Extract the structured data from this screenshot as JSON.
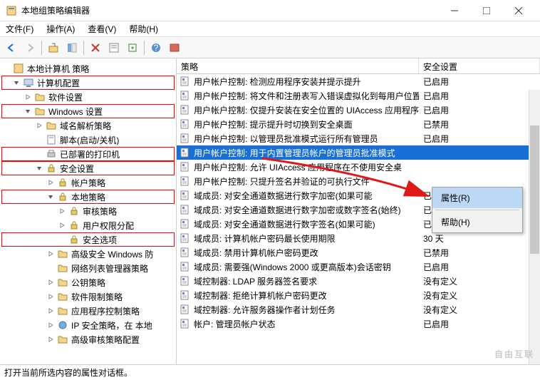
{
  "window": {
    "title": "本地组策略编辑器"
  },
  "menu": {
    "file": "文件(F)",
    "action": "操作(A)",
    "view": "查看(V)",
    "help": "帮助(H)"
  },
  "tree": [
    {
      "indent": 0,
      "label": "本地计算机 策略",
      "twisty": "",
      "icon": "policy",
      "hl": false
    },
    {
      "indent": 1,
      "label": "计算机配置",
      "twisty": "v",
      "icon": "computer",
      "hl": true
    },
    {
      "indent": 2,
      "label": "软件设置",
      "twisty": ">",
      "icon": "folder",
      "hl": false
    },
    {
      "indent": 2,
      "label": "Windows 设置",
      "twisty": "v",
      "icon": "folder",
      "hl": true
    },
    {
      "indent": 3,
      "label": "域名解析策略",
      "twisty": ">",
      "icon": "folder",
      "hl": false
    },
    {
      "indent": 3,
      "label": "脚本(启动/关机)",
      "twisty": "",
      "icon": "script",
      "hl": false
    },
    {
      "indent": 3,
      "label": "已部署的打印机",
      "twisty": "",
      "icon": "printer",
      "hl": true
    },
    {
      "indent": 3,
      "label": "安全设置",
      "twisty": "v",
      "icon": "lock",
      "hl": true
    },
    {
      "indent": 4,
      "label": "帐户策略",
      "twisty": ">",
      "icon": "lock",
      "hl": false
    },
    {
      "indent": 4,
      "label": "本地策略",
      "twisty": "v",
      "icon": "lock",
      "hl": true
    },
    {
      "indent": 5,
      "label": "审核策略",
      "twisty": ">",
      "icon": "lock",
      "hl": false
    },
    {
      "indent": 5,
      "label": "用户权限分配",
      "twisty": ">",
      "icon": "lock",
      "hl": false
    },
    {
      "indent": 5,
      "label": "安全选项",
      "twisty": "",
      "icon": "lock",
      "hl": true
    },
    {
      "indent": 4,
      "label": "高级安全 Windows 防",
      "twisty": ">",
      "icon": "folder",
      "hl": false
    },
    {
      "indent": 4,
      "label": "网络列表管理器策略",
      "twisty": "",
      "icon": "folder",
      "hl": false
    },
    {
      "indent": 4,
      "label": "公钥策略",
      "twisty": ">",
      "icon": "folder",
      "hl": false
    },
    {
      "indent": 4,
      "label": "软件限制策略",
      "twisty": ">",
      "icon": "folder",
      "hl": false
    },
    {
      "indent": 4,
      "label": "应用程序控制策略",
      "twisty": ">",
      "icon": "folder",
      "hl": false
    },
    {
      "indent": 4,
      "label": "IP 安全策略，在 本地",
      "twisty": ">",
      "icon": "ip",
      "hl": false
    },
    {
      "indent": 4,
      "label": "高级审核策略配置",
      "twisty": ">",
      "icon": "folder",
      "hl": false
    }
  ],
  "columns": {
    "policy": "策略",
    "setting": "安全设置"
  },
  "rows": [
    {
      "name": "用户帐户控制: 检测应用程序安装并提示提升",
      "setting": "已启用",
      "sel": false
    },
    {
      "name": "用户帐户控制: 将文件和注册表写入错误虚拟化到每用户位置",
      "setting": "已启用",
      "sel": false
    },
    {
      "name": "用户帐户控制: 仅提升安装在安全位置的 UIAccess 应用程序",
      "setting": "已启用",
      "sel": false
    },
    {
      "name": "用户帐户控制: 提示提升时切换到安全桌面",
      "setting": "已禁用",
      "sel": false
    },
    {
      "name": "用户帐户控制: 以管理员批准模式运行所有管理员",
      "setting": "已启用",
      "sel": false
    },
    {
      "name": "用户帐户控制: 用于内置管理员帐户的管理员批准模式",
      "setting": "",
      "sel": true
    },
    {
      "name": "用户帐户控制: 允许 UIAccess 应用程序在不使用安全桌",
      "setting": "",
      "sel": false
    },
    {
      "name": "用户帐户控制: 只提升签名并验证的可执行文件",
      "setting": "",
      "sel": false
    },
    {
      "name": "域成员: 对安全通道数据进行数字加密(如果可能",
      "setting": "已启用",
      "sel": false
    },
    {
      "name": "域成员: 对安全通道数据进行数字加密或数字签名(始终)",
      "setting": "已启用",
      "sel": false
    },
    {
      "name": "域成员: 对安全通道数据进行数字签名(如果可能)",
      "setting": "已启用",
      "sel": false
    },
    {
      "name": "域成员: 计算机帐户密码最长使用期限",
      "setting": "30 天",
      "sel": false
    },
    {
      "name": "域成员: 禁用计算机帐户密码更改",
      "setting": "已禁用",
      "sel": false
    },
    {
      "name": "域成员: 需要强(Windows 2000 或更高版本)会话密钥",
      "setting": "已启用",
      "sel": false
    },
    {
      "name": "域控制器: LDAP 服务器签名要求",
      "setting": "没有定义",
      "sel": false
    },
    {
      "name": "域控制器: 拒绝计算机帐户密码更改",
      "setting": "没有定义",
      "sel": false
    },
    {
      "name": "域控制器: 允许服务器操作者计划任务",
      "setting": "没有定义",
      "sel": false
    },
    {
      "name": "帐户: 管理员帐户状态",
      "setting": "已启用",
      "sel": false
    }
  ],
  "context": {
    "properties": "属性(R)",
    "help": "帮助(H)"
  },
  "status": "打开当前所选内容的属性对话框。",
  "watermark": {
    "main": "自由互联",
    "sub": ""
  }
}
